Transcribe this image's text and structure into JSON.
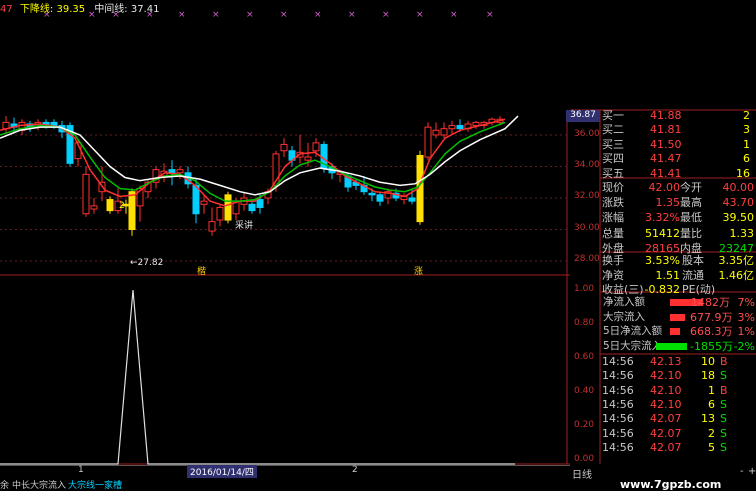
{
  "header": {
    "prefix": "47",
    "lower_line_label": "下降线:",
    "lower_line_value": "39.35",
    "mid_line_label": "中间线:",
    "mid_line_value": "37.41"
  },
  "markers": {
    "price_low": "←27.82",
    "label_a": "2",
    "label_b": "采讲",
    "label_c": "楷",
    "label_d": "涨",
    "current_price_tag": "36.87"
  },
  "price_axis": [
    "36.00",
    "34.00",
    "32.00",
    "30.00",
    "28.00"
  ],
  "indicator_axis": [
    "1.00",
    "0.80",
    "0.60",
    "0.40",
    "0.20",
    "0.00"
  ],
  "date_bar": {
    "left_tick": "1",
    "date": "2016/01/14/四",
    "right_tick": "2"
  },
  "bottom_tabs": [
    "余",
    "中长大宗流入",
    "大宗线一家槽"
  ],
  "period_label": "日线",
  "period_buttons": [
    "-",
    "+"
  ],
  "order_book": [
    {
      "label": "买一",
      "price": "41.88",
      "vol": "2"
    },
    {
      "label": "买二",
      "price": "41.81",
      "vol": "3"
    },
    {
      "label": "买三",
      "price": "41.50",
      "vol": "1"
    },
    {
      "label": "买四",
      "price": "41.47",
      "vol": "6"
    },
    {
      "label": "买五",
      "price": "41.41",
      "vol": "16"
    }
  ],
  "stats": [
    {
      "l1": "现价",
      "v1": "42.00",
      "l2": "今开",
      "v2": "40.00",
      "c1": "red",
      "c2": "red"
    },
    {
      "l1": "涨跌",
      "v1": "1.35",
      "l2": "最高",
      "v2": "43.70",
      "c1": "red",
      "c2": "red"
    },
    {
      "l1": "涨幅",
      "v1": "3.32%",
      "l2": "最低",
      "v2": "39.50",
      "c1": "red",
      "c2": "yel"
    },
    {
      "l1": "总量",
      "v1": "51412",
      "l2": "量比",
      "v2": "1.33",
      "c1": "yel",
      "c2": "yel"
    },
    {
      "l1": "外盘",
      "v1": "28165",
      "l2": "内盘",
      "v2": "23247",
      "c1": "red",
      "c2": "grn"
    }
  ],
  "fund": [
    {
      "l1": "换手",
      "v1": "3.53%",
      "l2": "股本",
      "v2": "3.35亿"
    },
    {
      "l1": "净资",
      "v1": "1.51",
      "l2": "流通",
      "v2": "1.46亿"
    },
    {
      "l1": "收益(三)",
      "v1": "-0.832",
      "l2": "PE(动)",
      "v2": ""
    }
  ],
  "flows": [
    {
      "label": "净流入额",
      "value": "1482万",
      "pct": "7%",
      "color": "#ff3030",
      "fill": 0.95
    },
    {
      "label": "大宗流入",
      "value": "677.9万",
      "pct": "3%",
      "color": "#ff3030",
      "fill": 0.45
    },
    {
      "label": "5日净流入额",
      "value": "668.3万",
      "pct": "1%",
      "color": "#ff3030",
      "fill": 0.3
    },
    {
      "label": "5日大宗流入",
      "value": "-1855万",
      "pct": "-2%",
      "color": "#00e000",
      "fill": 0.9
    }
  ],
  "ticks": [
    {
      "time": "14:56",
      "price": "42.13",
      "vol": "10",
      "side": "B"
    },
    {
      "time": "14:56",
      "price": "42.10",
      "vol": "18",
      "side": "S"
    },
    {
      "time": "14:56",
      "price": "42.10",
      "vol": "1",
      "side": "B"
    },
    {
      "time": "14:56",
      "price": "42.10",
      "vol": "6",
      "side": "S"
    },
    {
      "time": "14:56",
      "price": "42.07",
      "vol": "13",
      "side": "S"
    },
    {
      "time": "14:56",
      "price": "42.07",
      "vol": "2",
      "side": "S"
    },
    {
      "time": "14:56",
      "price": "42.07",
      "vol": "5",
      "side": "S"
    }
  ],
  "watermark": "www.7gpzb.com",
  "colors": {
    "up": "#ff3030",
    "down": "#00d0ff",
    "grid": "#a02020",
    "ma_fast": "#ff3030",
    "ma_mid": "#00c000",
    "ma_slow": "#ffffff"
  }
}
